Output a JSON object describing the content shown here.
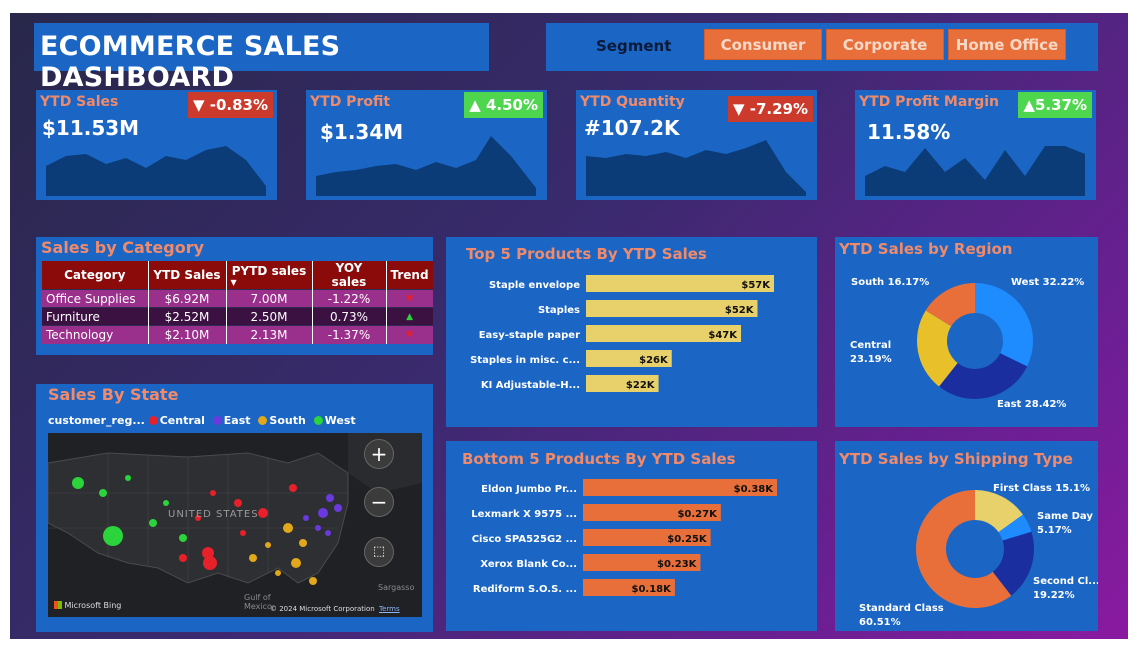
{
  "header": {
    "title": "ECOMMERCE SALES DASHBOARD"
  },
  "segment": {
    "label": "Segment",
    "options": [
      "Consumer",
      "Corporate",
      "Home Office"
    ]
  },
  "kpis": [
    {
      "title": "YTD Sales",
      "value": "$11.53M",
      "change": "▼ -0.83%",
      "direction": "down"
    },
    {
      "title": "YTD Profit",
      "value": "$1.34M",
      "change": "▲ 4.50%",
      "direction": "up"
    },
    {
      "title": "YTD Quantity",
      "value": "#107.2K",
      "change": "▼ -7.29%",
      "direction": "down"
    },
    {
      "title": "YTD Profit Margin",
      "value": "11.58%",
      "change": "▲5.37%",
      "direction": "up"
    }
  ],
  "category": {
    "title": "Sales by Category",
    "headers": [
      "Category",
      "YTD Sales",
      "PYTD sales",
      "YOY sales",
      "Trend"
    ],
    "rows": [
      {
        "category": "Office Supplies",
        "ytd": "$6.92M",
        "pytd": "7.00M",
        "yoy": "-1.22%",
        "trend": "down"
      },
      {
        "category": "Furniture",
        "ytd": "$2.52M",
        "pytd": "2.50M",
        "yoy": "0.73%",
        "trend": "up"
      },
      {
        "category": "Technology",
        "ytd": "$2.10M",
        "pytd": "2.13M",
        "yoy": "-1.37%",
        "trend": "down"
      }
    ]
  },
  "state": {
    "title": "Sales By State",
    "legend_title": "customer_reg...",
    "legend": [
      {
        "name": "Central",
        "color": "#e8202a"
      },
      {
        "name": "East",
        "color": "#6a3adf"
      },
      {
        "name": "South",
        "color": "#e0a81a"
      },
      {
        "name": "West",
        "color": "#2ad43a"
      }
    ],
    "map_label": "UNITED STATES",
    "gulf_label": "Gulf of Mexico",
    "sargasso_label": "Sargasso",
    "bing": "Microsoft Bing",
    "copyright": "© 2024 Microsoft Corporation",
    "terms": "Terms"
  },
  "top5": {
    "title": "Top 5 Products By YTD Sales",
    "color": "#e8d06a",
    "products": [
      "Staple envelope",
      "Staples",
      "Easy-staple paper",
      "Staples in misc. c...",
      "KI Adjustable-H..."
    ],
    "values": [
      57,
      52,
      47,
      26,
      22
    ],
    "labels": [
      "$57K",
      "$52K",
      "$47K",
      "$26K",
      "$22K"
    ]
  },
  "bottom5": {
    "title": "Bottom 5 Products By YTD Sales",
    "color": "#e86f3a",
    "products": [
      "Eldon Jumbo Pr...",
      "Lexmark X 9575 ...",
      "Cisco SPA525G2 ...",
      "Xerox Blank Co...",
      "Rediform S.O.S. ..."
    ],
    "values": [
      0.38,
      0.27,
      0.25,
      0.23,
      0.18
    ],
    "labels": [
      "$0.38K",
      "$0.27K",
      "$0.25K",
      "$0.23K",
      "$0.18K"
    ]
  },
  "region": {
    "title": "YTD Sales by Region",
    "slices": [
      {
        "name": "West",
        "pct": 32.22,
        "color": "#1e8bff",
        "label": "West 32.22%"
      },
      {
        "name": "East",
        "pct": 28.42,
        "color": "#1a2ea0",
        "label": "East 28.42%"
      },
      {
        "name": "Central",
        "pct": 23.19,
        "color": "#e8c02a",
        "label": "Central 23.19%"
      },
      {
        "name": "South",
        "pct": 16.17,
        "color": "#e86f3a",
        "label": "South 16.17%"
      }
    ]
  },
  "shipping": {
    "title": "YTD Sales by Shipping Type",
    "slices": [
      {
        "name": "First Class",
        "pct": 15.1,
        "color": "#e8d06a",
        "label": "First Class 15.1%"
      },
      {
        "name": "Same Day",
        "pct": 5.17,
        "color": "#1e8bff",
        "label": "Same Day 5.17%"
      },
      {
        "name": "Second Class",
        "pct": 19.22,
        "color": "#1a2ea0",
        "label": "Second Cl... 19.22%"
      },
      {
        "name": "Standard Class",
        "pct": 60.51,
        "color": "#e86f3a",
        "label": "Standard Class 60.51%"
      }
    ]
  },
  "chart_data": [
    {
      "type": "bar",
      "title": "Top 5 Products By YTD Sales",
      "categories": [
        "Staple envelope",
        "Staples",
        "Easy-staple paper",
        "Staples in misc. c...",
        "KI Adjustable-H..."
      ],
      "values": [
        57,
        52,
        47,
        26,
        22
      ],
      "unit": "$K"
    },
    {
      "type": "bar",
      "title": "Bottom 5 Products By YTD Sales",
      "categories": [
        "Eldon Jumbo Pr...",
        "Lexmark X 9575 ...",
        "Cisco SPA525G2 ...",
        "Xerox Blank Co...",
        "Rediform S.O.S. ..."
      ],
      "values": [
        0.38,
        0.27,
        0.25,
        0.23,
        0.18
      ],
      "unit": "$K"
    },
    {
      "type": "pie",
      "title": "YTD Sales by Region",
      "categories": [
        "West",
        "East",
        "Central",
        "South"
      ],
      "values": [
        32.22,
        28.42,
        23.19,
        16.17
      ]
    },
    {
      "type": "pie",
      "title": "YTD Sales by Shipping Type",
      "categories": [
        "First Class",
        "Same Day",
        "Second Class",
        "Standard Class"
      ],
      "values": [
        15.1,
        5.17,
        19.22,
        60.51
      ]
    }
  ]
}
